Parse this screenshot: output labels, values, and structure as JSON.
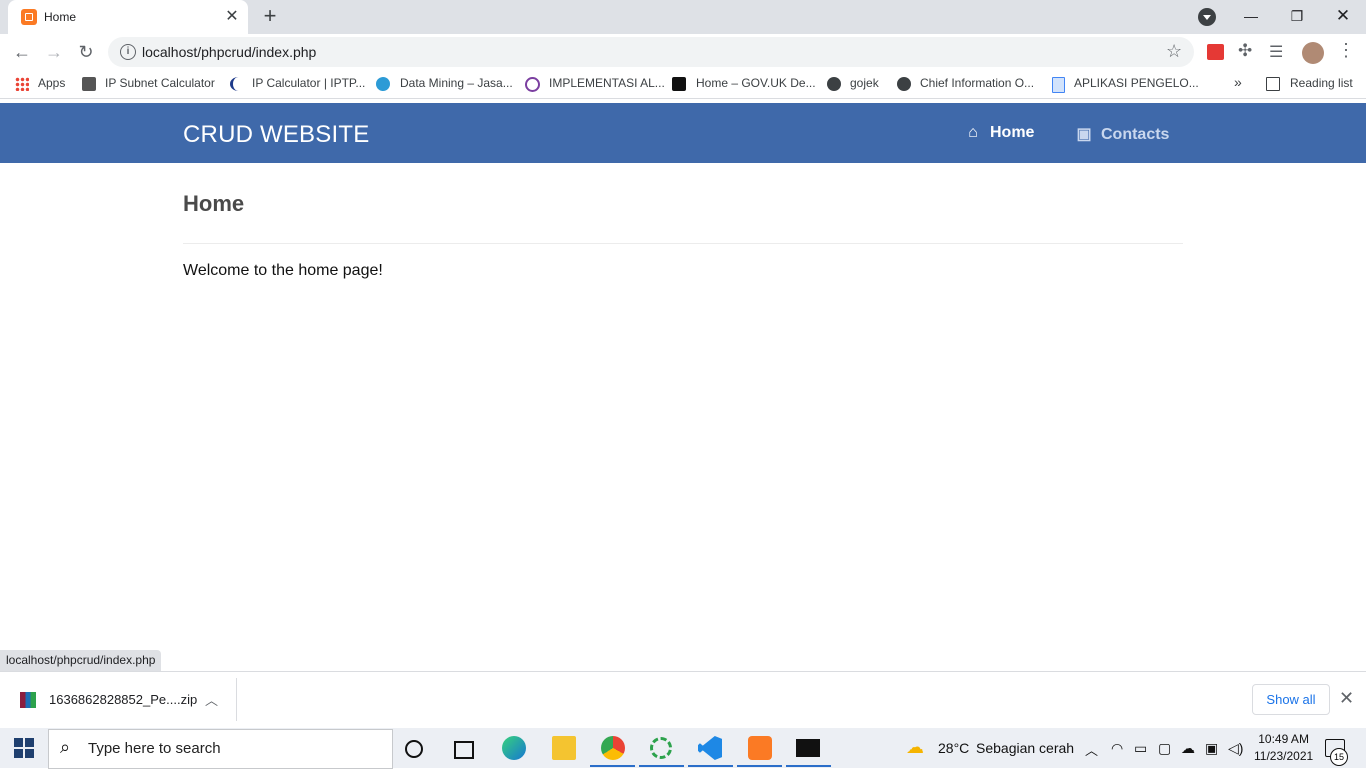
{
  "browser": {
    "tab": {
      "title": "Home"
    },
    "url": "localhost/phpcrud/index.php",
    "bookmarks": [
      {
        "label": "Apps",
        "icon": "apps-grid-icon"
      },
      {
        "label": "IP Subnet Calculator",
        "icon": "calculator-icon"
      },
      {
        "label": "IP Calculator | IPTP...",
        "icon": "crescent-icon"
      },
      {
        "label": "Data Mining – Jasa...",
        "icon": "wordpress-icon"
      },
      {
        "label": "IMPLEMENTASI AL...",
        "icon": "at-icon"
      },
      {
        "label": "Home – GOV.UK De...",
        "icon": "crown-icon"
      },
      {
        "label": "gojek",
        "icon": "globe-icon"
      },
      {
        "label": "Chief Information O...",
        "icon": "globe-icon"
      },
      {
        "label": "APLIKASI PENGELO...",
        "icon": "document-icon"
      }
    ],
    "more_bookmarks": "»",
    "reading_list": "Reading list",
    "status_url": "localhost/phpcrud/index.php"
  },
  "site": {
    "brand": "CRUD WEBSITE",
    "nav": {
      "home": "Home",
      "contacts": "Contacts"
    },
    "page_title": "Home",
    "welcome": "Welcome to the home page!"
  },
  "download": {
    "filename": "1636862828852_Pe....zip",
    "show_all": "Show all"
  },
  "taskbar": {
    "search_placeholder": "Type here to search",
    "weather_temp": "28°C",
    "weather_text": "Sebagian cerah",
    "time": "10:49 AM",
    "date": "11/23/2021",
    "notification_count": "15"
  },
  "colors": {
    "navbar": "#3f69aa",
    "nav_active": "#ffffff",
    "nav_inactive": "#c9d7ee"
  }
}
